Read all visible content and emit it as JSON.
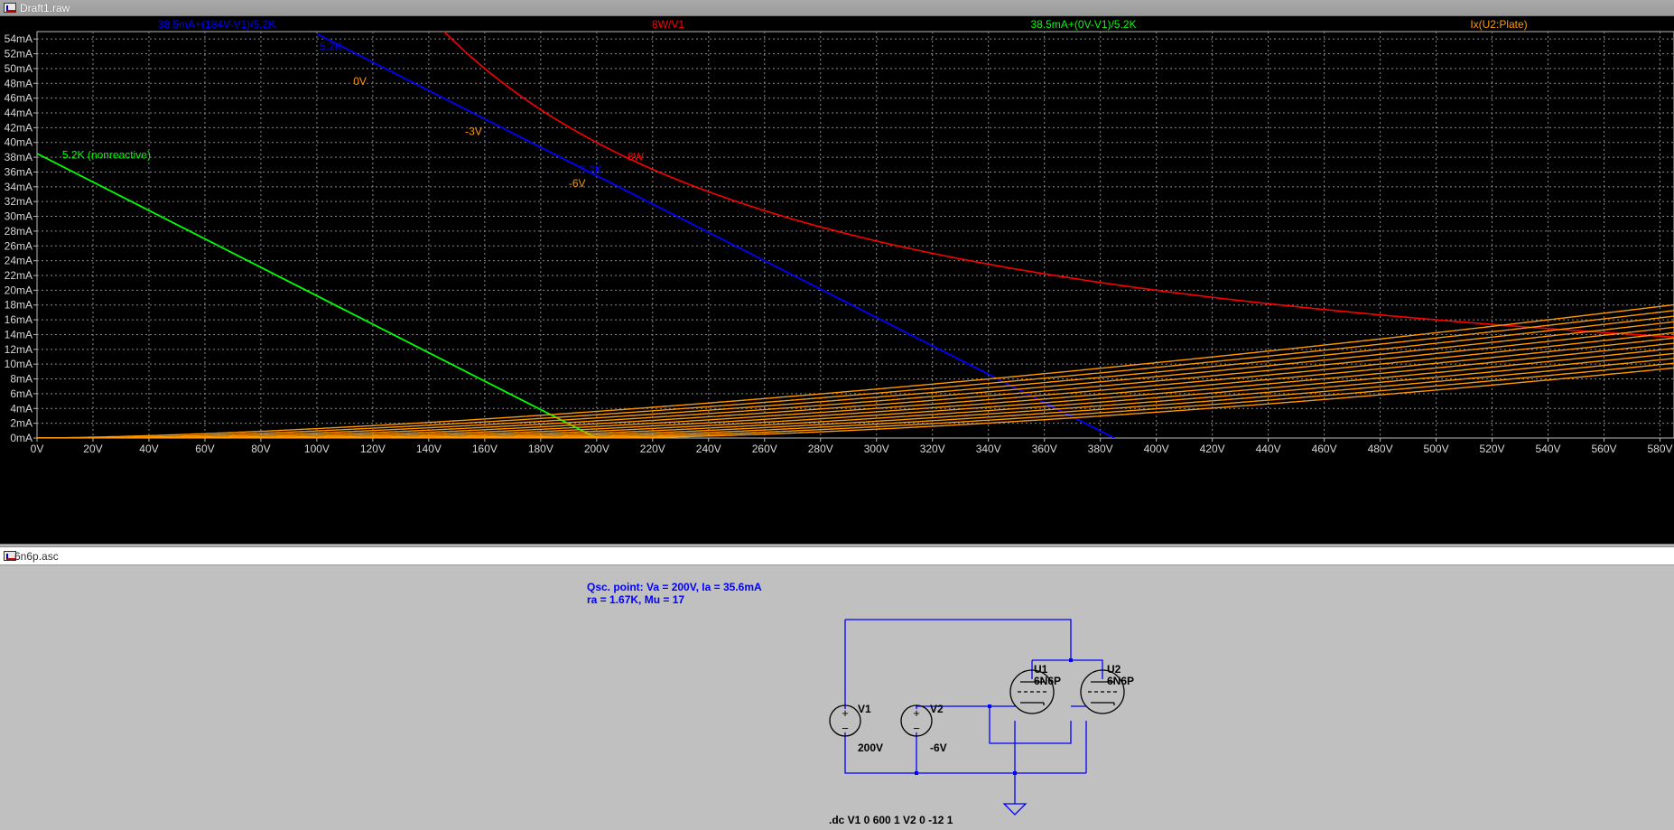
{
  "window": {
    "waveform_title": "Draft1.raw",
    "schematic_title": "6n6p.asc"
  },
  "chart_data": {
    "type": "line",
    "title": "",
    "xlabel": "",
    "ylabel": "",
    "xlim": [
      0,
      585
    ],
    "ylim": [
      0,
      55
    ],
    "x_ticks": [
      0,
      20,
      40,
      60,
      80,
      100,
      120,
      140,
      160,
      180,
      200,
      220,
      240,
      260,
      280,
      300,
      320,
      340,
      360,
      380,
      400,
      420,
      440,
      460,
      480,
      500,
      520,
      540,
      560,
      580
    ],
    "x_tick_labels": [
      "0V",
      "20V",
      "40V",
      "60V",
      "80V",
      "100V",
      "120V",
      "140V",
      "160V",
      "180V",
      "200V",
      "220V",
      "240V",
      "260V",
      "280V",
      "300V",
      "320V",
      "340V",
      "360V",
      "380V",
      "400V",
      "420V",
      "440V",
      "460V",
      "480V",
      "500V",
      "520V",
      "540V",
      "560V",
      "580V"
    ],
    "y_ticks": [
      0,
      2,
      4,
      6,
      8,
      10,
      12,
      14,
      16,
      18,
      20,
      22,
      24,
      26,
      28,
      30,
      32,
      34,
      36,
      38,
      40,
      42,
      44,
      46,
      48,
      50,
      52,
      54
    ],
    "y_tick_labels": [
      "0mA",
      "2mA",
      "4mA",
      "6mA",
      "8mA",
      "10mA",
      "12mA",
      "14mA",
      "16mA",
      "18mA",
      "20mA",
      "22mA",
      "24mA",
      "26mA",
      "28mA",
      "30mA",
      "32mA",
      "34mA",
      "36mA",
      "38mA",
      "40mA",
      "42mA",
      "44mA",
      "46mA",
      "48mA",
      "50mA",
      "52mA",
      "54mA"
    ],
    "grid": true,
    "legend": [
      {
        "label": "38.5mA+(184V-V1)/5.2K",
        "color": "#0000ff"
      },
      {
        "label": "8W/V1",
        "color": "#ff0000"
      },
      {
        "label": "38.5mA+(0V-V1)/5.2K",
        "color": "#00ff00"
      },
      {
        "label": "Ix(U2:Plate)",
        "color": "#ff9900"
      }
    ],
    "series": [
      {
        "name": "38.5mA+(184V-V1)/5.2K",
        "color": "#0000ff",
        "kind": "line",
        "x": [
          100,
          385
        ],
        "y": [
          54.7,
          0
        ]
      },
      {
        "name": "8W/V1",
        "color": "#ff0000",
        "kind": "power",
        "watts": 8,
        "x_range": [
          145,
          585
        ]
      },
      {
        "name": "38.5mA+(0V-V1)/5.2K",
        "color": "#00ff00",
        "kind": "line",
        "x": [
          0,
          200
        ],
        "y": [
          38.5,
          0
        ]
      },
      {
        "name": "Ix(U2:Plate)",
        "color": "#ff9900",
        "kind": "family",
        "k": 1.275e-06,
        "mu": 17,
        "exp": 1.5,
        "vg": [
          0,
          -1,
          -2,
          -3,
          -4,
          -5,
          -6,
          -7,
          -8,
          -9,
          -10,
          -11,
          -12
        ]
      }
    ],
    "annotations": [
      {
        "text": "5.2K",
        "x": 101,
        "y": 52.5,
        "color": "#0000ff"
      },
      {
        "text": "0V",
        "x": 113,
        "y": 47.8,
        "color": "#ff9900"
      },
      {
        "text": "-3V",
        "x": 153,
        "y": 41,
        "color": "#ff9900"
      },
      {
        "text": "8W",
        "x": 211,
        "y": 37.6,
        "color": "#ff0000"
      },
      {
        "text": "5.2K",
        "x": 194,
        "y": 35.8,
        "color": "#0000ff"
      },
      {
        "text": "-6V",
        "x": 190,
        "y": 34,
        "color": "#ff9900"
      },
      {
        "text": "5.2K (nonreactive)",
        "x": 9,
        "y": 37.8,
        "color": "#00ff00"
      }
    ]
  },
  "schematic": {
    "note_line1": "Qsc. point: Va = 200V, Ia = 35.6mA",
    "note_line2": "ra = 1.67K, Mu = 17",
    "directive": ".dc V1 0 600 1 V2 0 -12 1",
    "v1_name": "V1",
    "v1_value": "200V",
    "v2_name": "V2",
    "v2_value": "-6V",
    "u1_name": "U1",
    "u1_model": "6N6P",
    "u2_name": "U2",
    "u2_model": "6N6P",
    "colors": {
      "wire": "#0000ff",
      "text": "#000000",
      "note": "#0000ff"
    }
  }
}
